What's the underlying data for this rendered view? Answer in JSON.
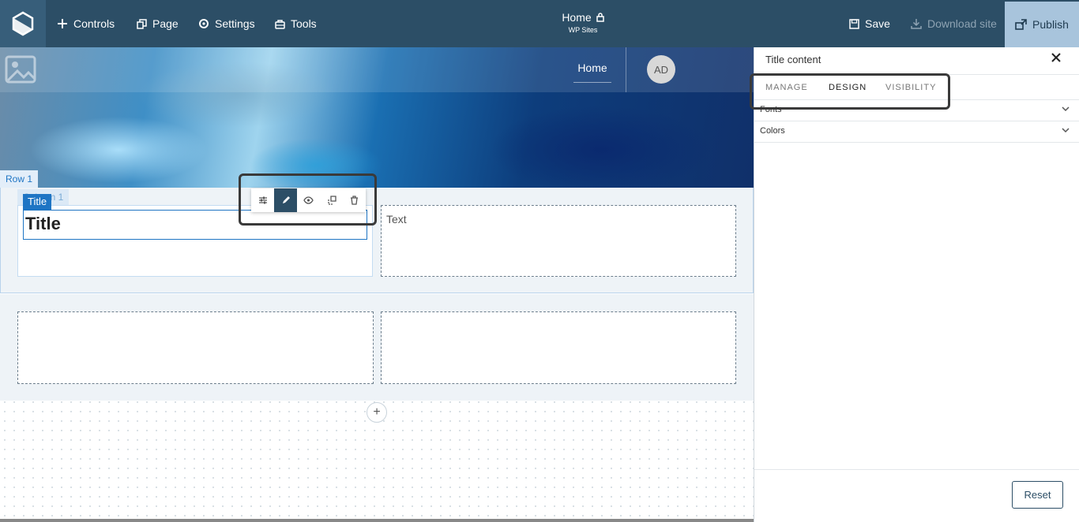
{
  "topbar": {
    "controls_label": "Controls",
    "page_label": "Page",
    "settings_label": "Settings",
    "tools_label": "Tools",
    "page_title": "Home",
    "site_name": "WP Sites",
    "save_label": "Save",
    "download_label": "Download site",
    "publish_label": "Publish"
  },
  "header": {
    "nav_home": "Home",
    "avatar_initials": "AD"
  },
  "canvas": {
    "row_label": "Row 1",
    "column_label": "Column 1",
    "title_tag": "Title",
    "title_text": "Title",
    "text_block": "Text",
    "add_symbol": "+"
  },
  "panel": {
    "title": "Title content",
    "tabs": [
      {
        "label": "MANAGE",
        "active": false
      },
      {
        "label": "DESIGN",
        "active": true
      },
      {
        "label": "VISIBILITY",
        "active": false
      }
    ],
    "sections": [
      {
        "label": "Fonts"
      },
      {
        "label": "Colors"
      }
    ],
    "reset_label": "Reset"
  },
  "colors": {
    "topbar": "#2c4e66",
    "accent": "#1e75c4",
    "publish_bg": "#a8c4dc"
  },
  "icons": [
    "logo-icon",
    "plus-icon",
    "page-icon",
    "gear-icon",
    "toolbox-icon",
    "lock-icon",
    "save-icon",
    "download-icon",
    "publish-icon",
    "image-icon",
    "sliders-icon",
    "pencil-icon",
    "eye-icon",
    "move-icon",
    "trash-icon",
    "close-icon",
    "chevron-down-icon"
  ]
}
